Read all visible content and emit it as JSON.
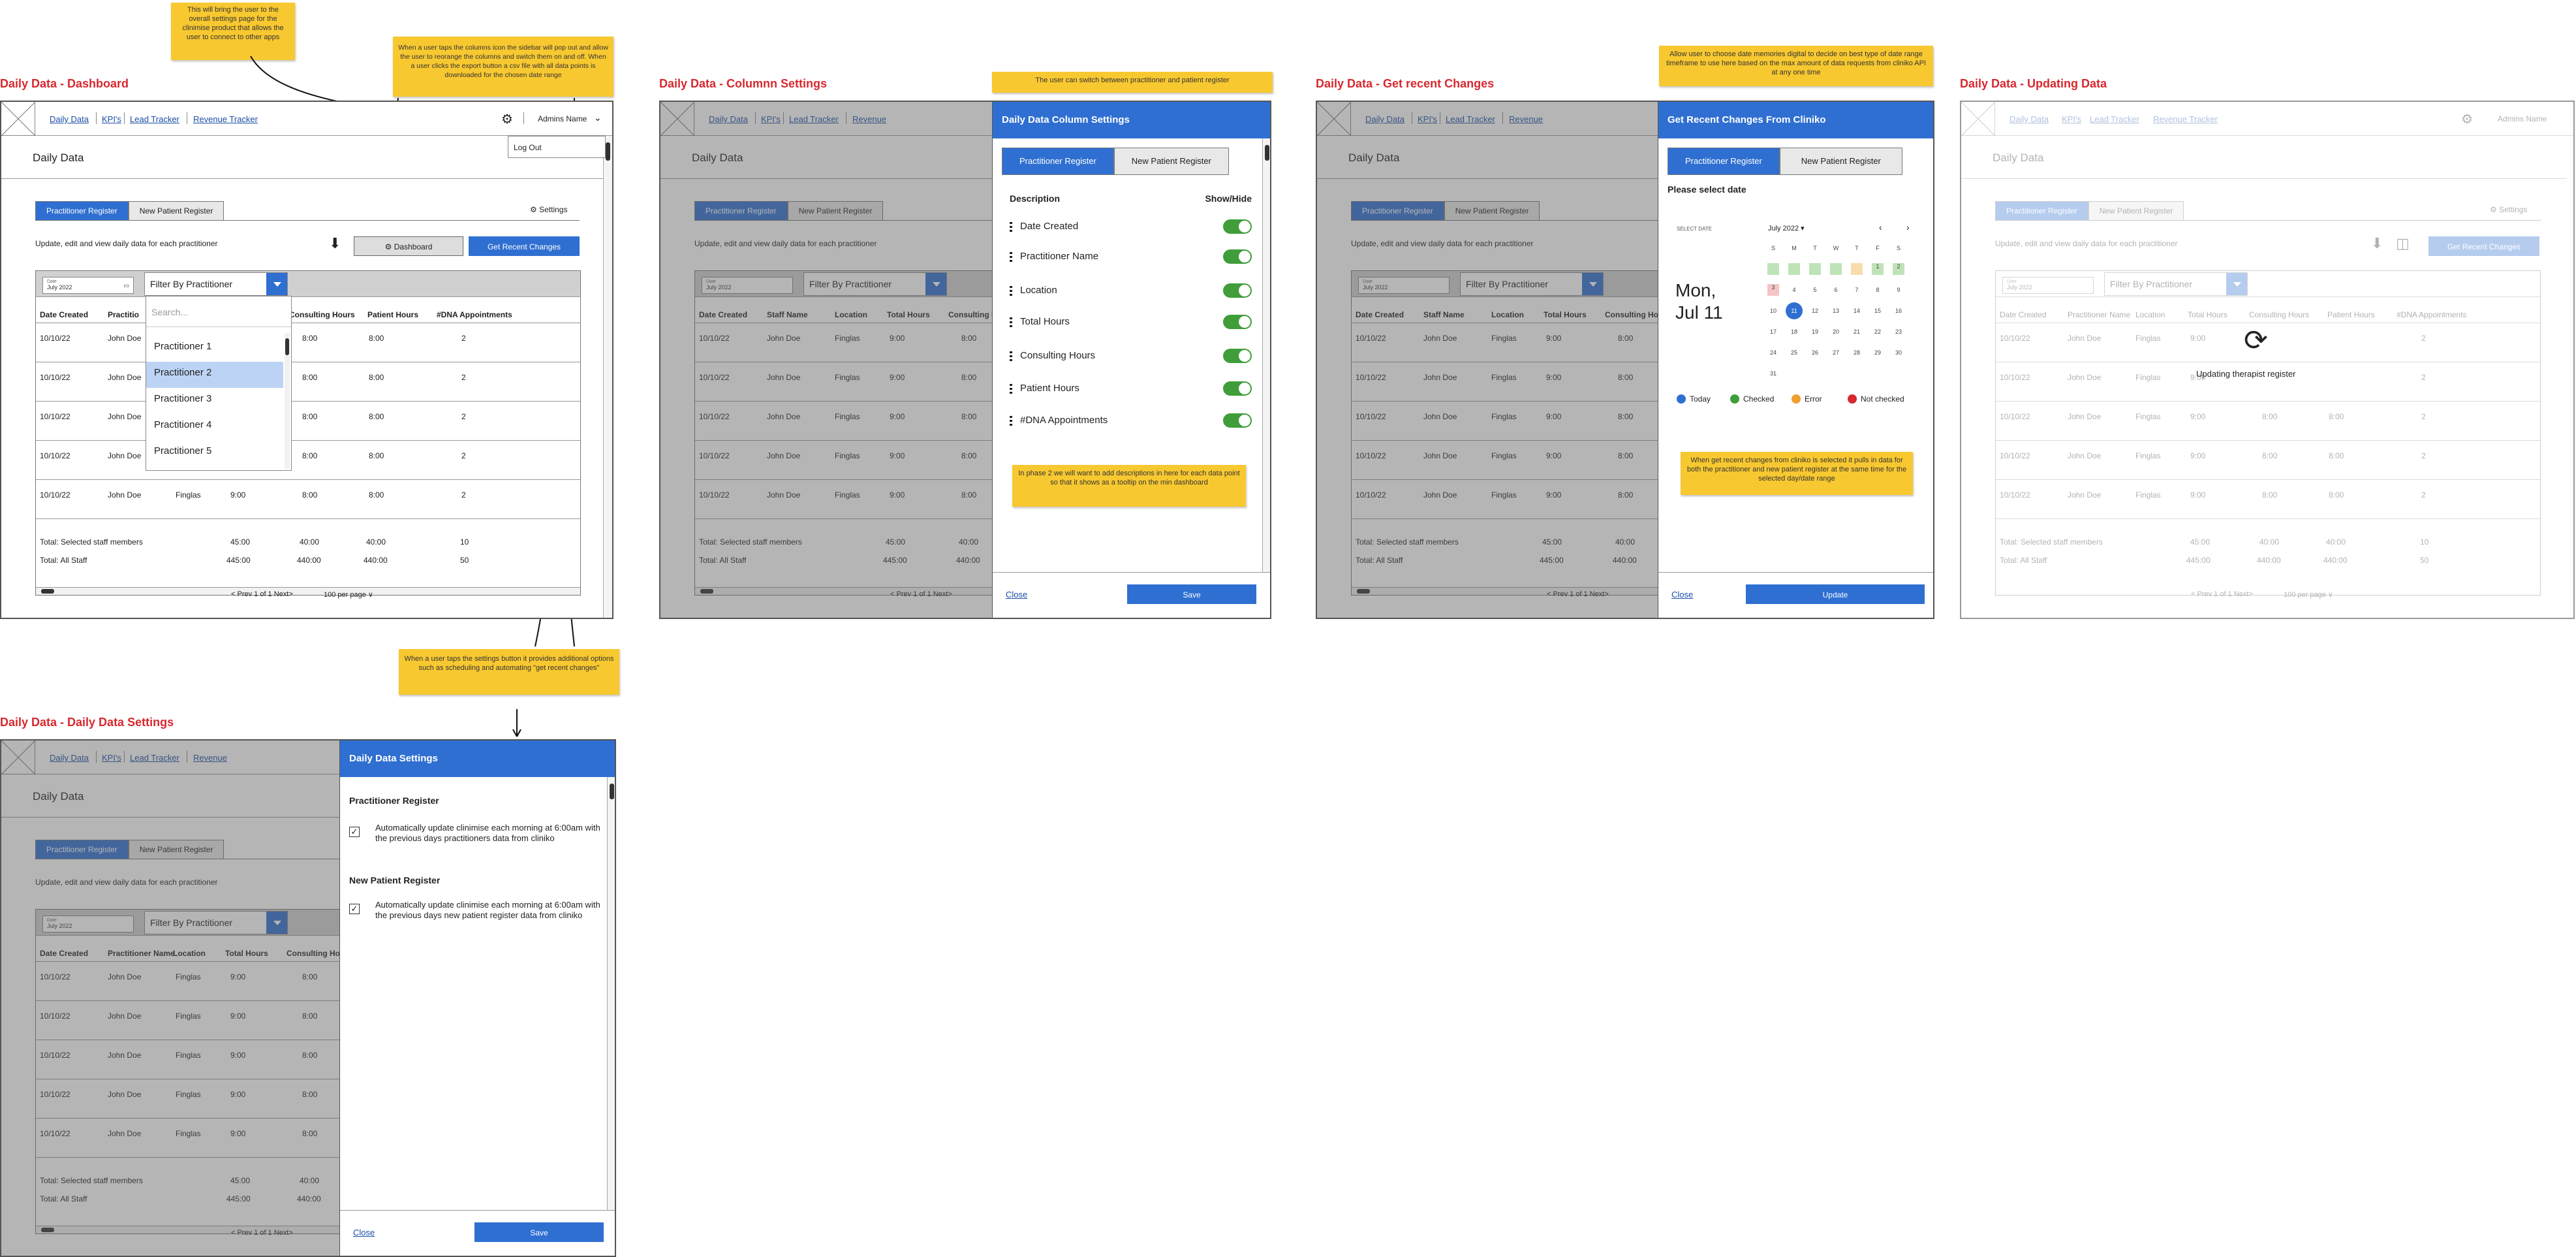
{
  "screens": {
    "dashboard": {
      "title": "Daily Data - Dashboard"
    },
    "columns": {
      "title": "Daily Data - Columnn Settings"
    },
    "recent": {
      "title": "Daily Data  - Get recent Changes"
    },
    "updating": {
      "title": "Daily Data - Updating Data"
    },
    "settings": {
      "title": "Daily Data - Daily Data Settings"
    }
  },
  "notes": {
    "gear": "This will bring the user to the overall settings page for the clinimise product that allows the user to connect to other apps",
    "columns": "When a user taps the columns icon the sidebar will pop out and allow the user to reorange the columns and switch them on and off. When a user clicks the export button a csv file with all data points is downloaded for the chosen date range",
    "switch": "The user can switch between practitioner and patient register",
    "daterange": "Allow user to choose date memories digital to decide on best type of date range timeframe to use here based on the max amount of data requests from cliniko API at any one time",
    "settings": "When a user taps the settings button it provides additional options such as scheduling and automating \"get recent changes\"",
    "tooltip": "In phase 2 we will want to add descriptions in here for each data point so that it shows as a tooltip on the min dashboard",
    "recent": "When get recent changes from cliniko is selected it pulls in data for both the practitioner and new patient register at the same time for the selected day/date range"
  },
  "nav": {
    "daily": "Daily Data",
    "kpis": "KPI's",
    "lead": "Lead Tracker",
    "revenue": "Revenue Tracker",
    "revenue_short": "Revenue",
    "admin": "Admins Name",
    "logout": "Log Out"
  },
  "page": {
    "heading": "Daily Data",
    "subtitle": "Update, edit and view daily data for each practitioner",
    "settings": "Settings",
    "dashboard_btn": "Dashboard",
    "recent_btn": "Get Recent Changes"
  },
  "tabs": {
    "practitioner": "Practitioner Register",
    "patient": "New Patient Register"
  },
  "toolbar": {
    "date_label": "Date",
    "date_value": "July 2022",
    "filter": "Filter By Practitioner"
  },
  "dropdown": {
    "search": "Search...",
    "items": [
      "Practitioner 1",
      "Practitioner 2",
      "Practitioner 3",
      "Practitioner 4",
      "Practitioner 5"
    ]
  },
  "table": {
    "headers": [
      "Date Created",
      "Practitioner Name",
      "Location",
      "Total Hours",
      "Consulting Hours",
      "Patient Hours",
      "#DNA Appointments"
    ],
    "headers_staff": [
      "Date Created",
      "Staff Name",
      "Location",
      "Total Hours",
      "Consulting Hours"
    ],
    "headers_dash_short": [
      "Date Created",
      "Practitio"
    ],
    "rows": [
      [
        "10/10/22",
        "John Doe",
        "Finglas",
        "9:00",
        "8:00",
        "8:00",
        "2"
      ],
      [
        "10/10/22",
        "John Doe",
        "Finglas",
        "9:00",
        "8:00",
        "8:00",
        "2"
      ],
      [
        "10/10/22",
        "John Doe",
        "Finglas",
        "9:00",
        "8:00",
        "8:00",
        "2"
      ],
      [
        "10/10/22",
        "John Doe",
        "Finglas",
        "9:00",
        "8:00",
        "8:00",
        "2"
      ],
      [
        "10/10/22",
        "John Doe",
        "Finglas",
        "9:00",
        "8:00",
        "8:00",
        "2"
      ]
    ],
    "total_selected": {
      "label": "Total: Selected staff members",
      "v1": "45:00",
      "v2": "40:00",
      "v3": "40:00",
      "v4": "10"
    },
    "total_all": {
      "label": "Total: All Staff",
      "v1": "445:00",
      "v2": "440:00",
      "v3": "440:00",
      "v4": "50"
    }
  },
  "pager": {
    "nav": "< Prev 1 of 1 Next>",
    "per_page": "100 per page ∨"
  },
  "column_settings": {
    "title": "Daily Data Column Settings",
    "description": "Description",
    "showhide": "Show/Hide",
    "columns": [
      "Date Created",
      "Practitioner Name",
      "Location",
      "Total Hours",
      "Consulting Hours",
      "Patient Hours",
      "#DNA Appointments"
    ],
    "close": "Close",
    "save": "Save"
  },
  "recent_panel": {
    "title": "Get Recent Changes From Cliniko",
    "prompt": "Please select date",
    "select_date": "SELECT DATE",
    "month": "July 2022",
    "big_date_1": "Mon,",
    "big_date_2": "Jul 11",
    "weekdays": [
      "S",
      "M",
      "T",
      "W",
      "T",
      "F",
      "S"
    ],
    "days": [
      [
        "",
        "",
        "",
        "",
        "",
        "1",
        "2"
      ],
      [
        "3",
        "4",
        "5",
        "6",
        "7",
        "8",
        "9"
      ],
      [
        "10",
        "11",
        "12",
        "13",
        "14",
        "15",
        "16"
      ],
      [
        "17",
        "18",
        "19",
        "20",
        "21",
        "22",
        "23"
      ],
      [
        "24",
        "25",
        "26",
        "27",
        "28",
        "29",
        "30"
      ],
      [
        "31",
        "",
        "",
        "",
        "",
        "",
        ""
      ]
    ],
    "legend": [
      "Today",
      "Checked",
      "Error",
      "Not checked"
    ],
    "close": "Close",
    "update": "Update"
  },
  "updating": {
    "message": "Updating therapist register"
  },
  "settings_panel": {
    "title": "Daily Data Settings",
    "section1": "Practitioner Register",
    "opt1": "Automatically update clinimise each morning at 6:00am with the previous days practitioners data from cliniko",
    "section2": "New Patient Register",
    "opt2": "Automatically update clinimise each morning at 6:00am with the previous days new patient register data from cliniko",
    "close": "Close",
    "save": "Save"
  },
  "colors": {
    "accent": "#2f6fd1",
    "title_red": "#d7282f",
    "note_yellow": "#f8c830",
    "toggle_green": "#3f9e3a"
  }
}
